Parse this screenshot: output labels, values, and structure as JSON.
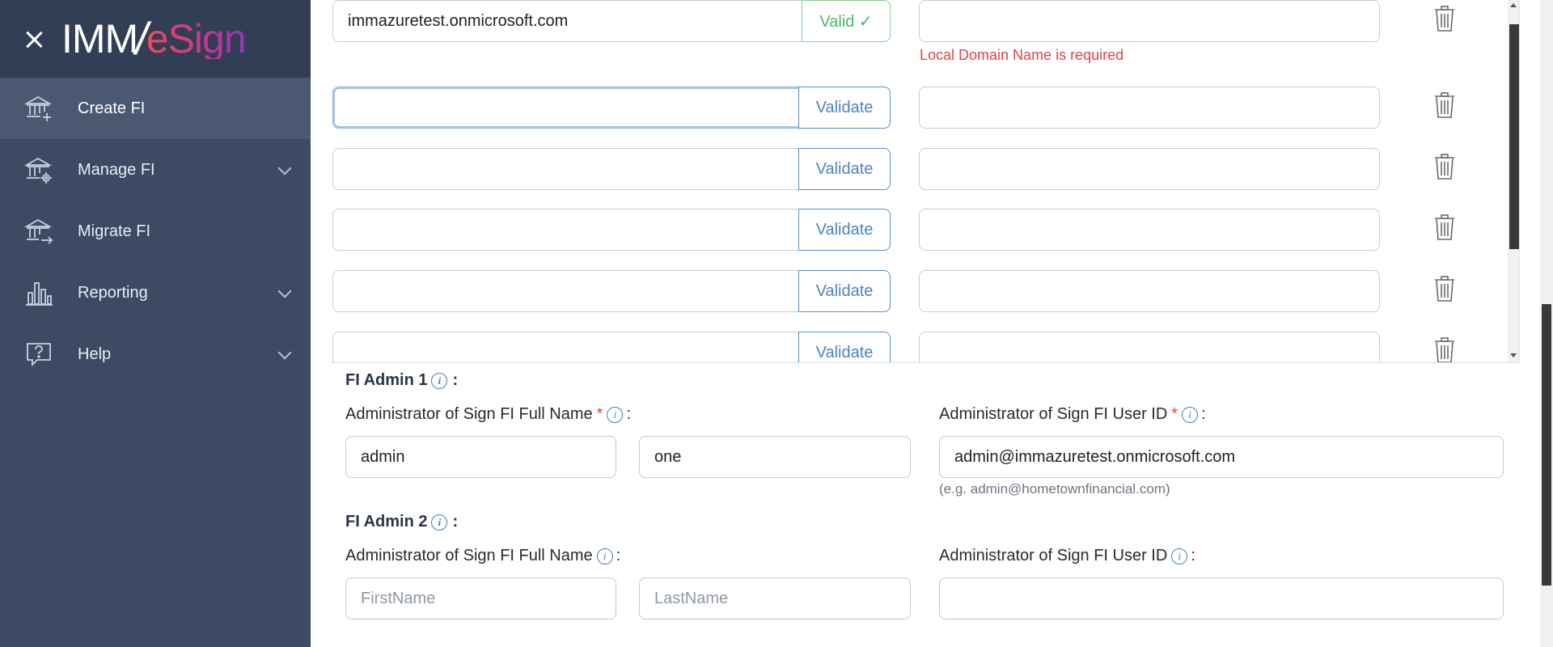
{
  "app": {
    "logo_imm": "IMM",
    "logo_slash": "/",
    "logo_esign": "eSign"
  },
  "sidebar": {
    "items": [
      {
        "label": "Create FI",
        "icon": "bank-plus-icon",
        "active": true,
        "expandable": false
      },
      {
        "label": "Manage FI",
        "icon": "bank-gear-icon",
        "active": false,
        "expandable": true
      },
      {
        "label": "Migrate FI",
        "icon": "bank-arrow-icon",
        "active": false,
        "expandable": false
      },
      {
        "label": "Reporting",
        "icon": "bar-chart-icon",
        "active": false,
        "expandable": true
      },
      {
        "label": "Help",
        "icon": "help-bubble-icon",
        "active": false,
        "expandable": true
      }
    ]
  },
  "domains": {
    "rows": [
      {
        "domain_value": "immazuretest.onmicrosoft.com",
        "button": "Valid ✓",
        "status": "valid",
        "local_value": "",
        "error": "Local Domain Name is required"
      },
      {
        "domain_value": "",
        "button": "Validate",
        "status": "focused",
        "local_value": ""
      },
      {
        "domain_value": "",
        "button": "Validate",
        "status": "",
        "local_value": ""
      },
      {
        "domain_value": "",
        "button": "Validate",
        "status": "",
        "local_value": ""
      },
      {
        "domain_value": "",
        "button": "Validate",
        "status": "",
        "local_value": ""
      },
      {
        "domain_value": "",
        "button": "Validate",
        "status": "",
        "local_value": ""
      }
    ]
  },
  "admin1": {
    "title": "FI Admin 1",
    "full_name_label": "Administrator of Sign FI Full Name",
    "required_mark": "*",
    "first_name": "admin",
    "last_name": "one",
    "user_id_label": "Administrator of Sign FI User ID",
    "user_id": "admin@immazuretest.onmicrosoft.com",
    "user_id_hint": "(e.g. admin@hometownfinancial.com)"
  },
  "admin2": {
    "title": "FI Admin 2",
    "full_name_label": "Administrator of Sign FI Full Name",
    "first_name_placeholder": "FirstName",
    "last_name_placeholder": "LastName",
    "user_id_label": "Administrator of Sign FI User ID",
    "user_id": ""
  },
  "info_glyph": "i",
  "colon": ":"
}
